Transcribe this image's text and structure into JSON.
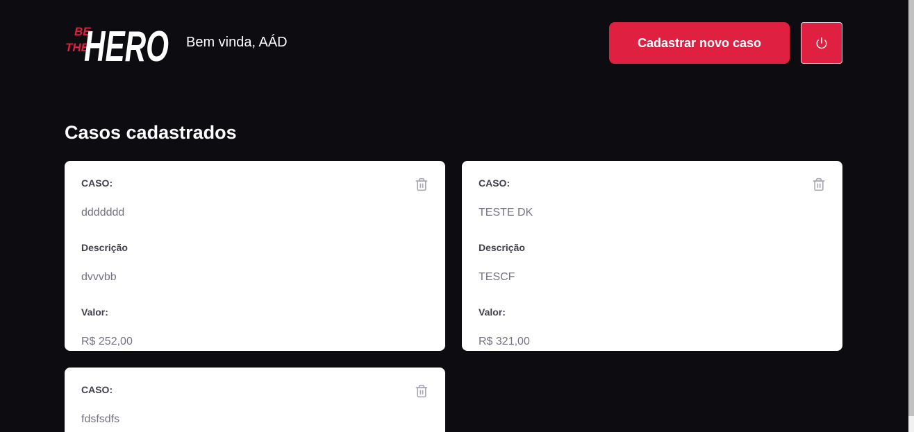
{
  "header": {
    "logo_text": "BE THE HERO",
    "welcome": "Bem vinda, AÁD",
    "new_case_label": "Cadastrar novo caso"
  },
  "main": {
    "section_title": "Casos cadastrados",
    "labels": {
      "case": "CASO:",
      "description": "Descrição",
      "value": "Valor:"
    },
    "cases": [
      {
        "title": "ddddddd",
        "description": "dvvvbb",
        "value": "R$ 252,00"
      },
      {
        "title": "TESTE DK",
        "description": "TESCF",
        "value": "R$ 321,00"
      },
      {
        "title": "fdsfsdfs"
      }
    ]
  },
  "colors": {
    "background": "#0d0c10",
    "accent": "#e02041",
    "card": "#ffffff",
    "label": "#41414d",
    "value": "#737380",
    "icon": "#a8a8b3"
  },
  "icons": [
    "power-icon",
    "trash-icon"
  ]
}
